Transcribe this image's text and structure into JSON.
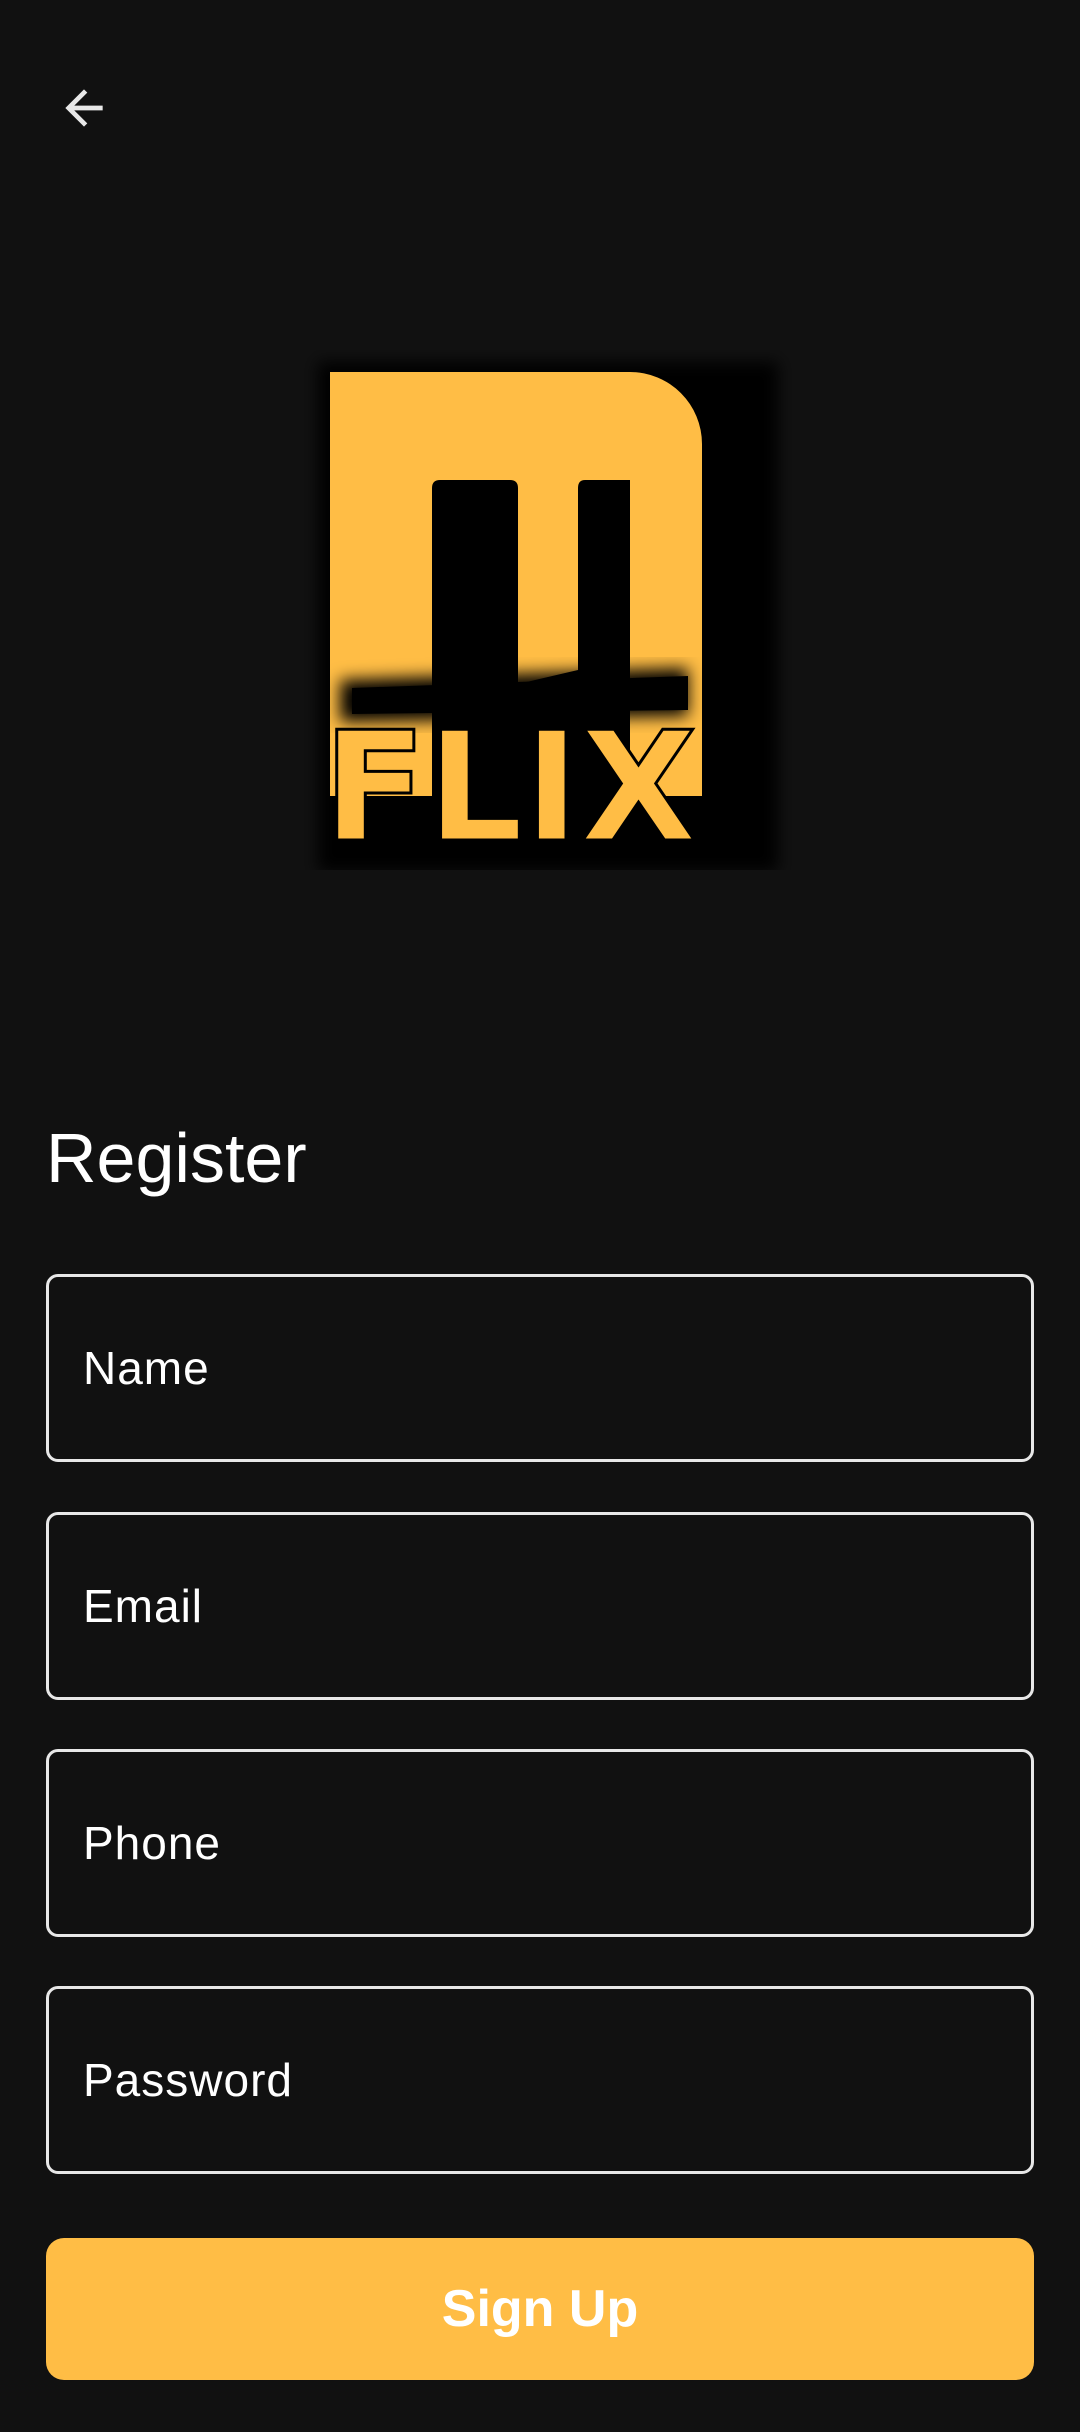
{
  "header": {
    "back_icon": "arrow-left-icon"
  },
  "logo": {
    "text": "FLIX",
    "accent_color": "#FFBD45"
  },
  "form": {
    "title": "Register",
    "name_placeholder": "Name",
    "email_placeholder": "Email",
    "phone_placeholder": "Phone",
    "password_placeholder": "Password",
    "submit_label": "Sign Up"
  },
  "colors": {
    "background": "#111111",
    "accent": "#FFBD45",
    "text": "#FFFFFF",
    "field_border": "#E8E8E8"
  }
}
